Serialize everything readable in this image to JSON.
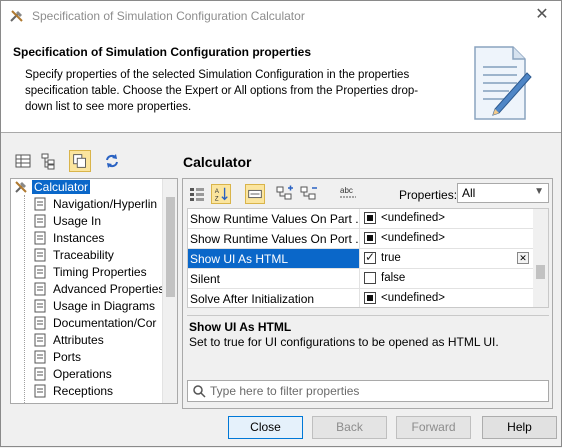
{
  "window": {
    "title": "Specification of Simulation Configuration Calculator"
  },
  "header": {
    "title": "Specification of Simulation Configuration properties",
    "description": "Specify properties of the selected Simulation Configuration in the properties specification table. Choose the Expert or All options from the Properties drop-down list to see more properties."
  },
  "toolbar": {
    "icons": [
      "table-view-icon",
      "tree-view-icon",
      "copy-icon",
      "refresh-icon"
    ]
  },
  "tree": {
    "root": "Calculator",
    "items": [
      "Navigation/Hyperlin",
      "Usage In",
      "Instances",
      "Traceability",
      "Timing Properties",
      "Advanced Properties",
      "Usage in Diagrams",
      "Documentation/Cor",
      "Attributes",
      "Ports",
      "Operations",
      "Receptions"
    ]
  },
  "panel": {
    "title": "Calculator",
    "properties_label": "Properties:",
    "properties_value": "All",
    "rows": [
      {
        "name": "Show Runtime Values On Part ...",
        "value": "<undefined>",
        "kind": "filled"
      },
      {
        "name": "Show Runtime Values On Port ...",
        "value": "<undefined>",
        "kind": "filled"
      },
      {
        "name": "Show UI As HTML",
        "value": "true",
        "kind": "check",
        "selected": true
      },
      {
        "name": "Silent",
        "value": "false",
        "kind": "empty"
      },
      {
        "name": "Solve After Initialization",
        "value": "<undefined>",
        "kind": "filled"
      }
    ],
    "description_title": "Show UI As HTML",
    "description_text": "Set to true for UI configurations to be opened as HTML UI.",
    "filter_placeholder": "Type here to filter properties"
  },
  "footer": {
    "close": "Close",
    "back": "Back",
    "forward": "Forward",
    "help": "Help"
  },
  "colors": {
    "selection": "#0a67c9",
    "active_toggle": "#fbe59e"
  }
}
